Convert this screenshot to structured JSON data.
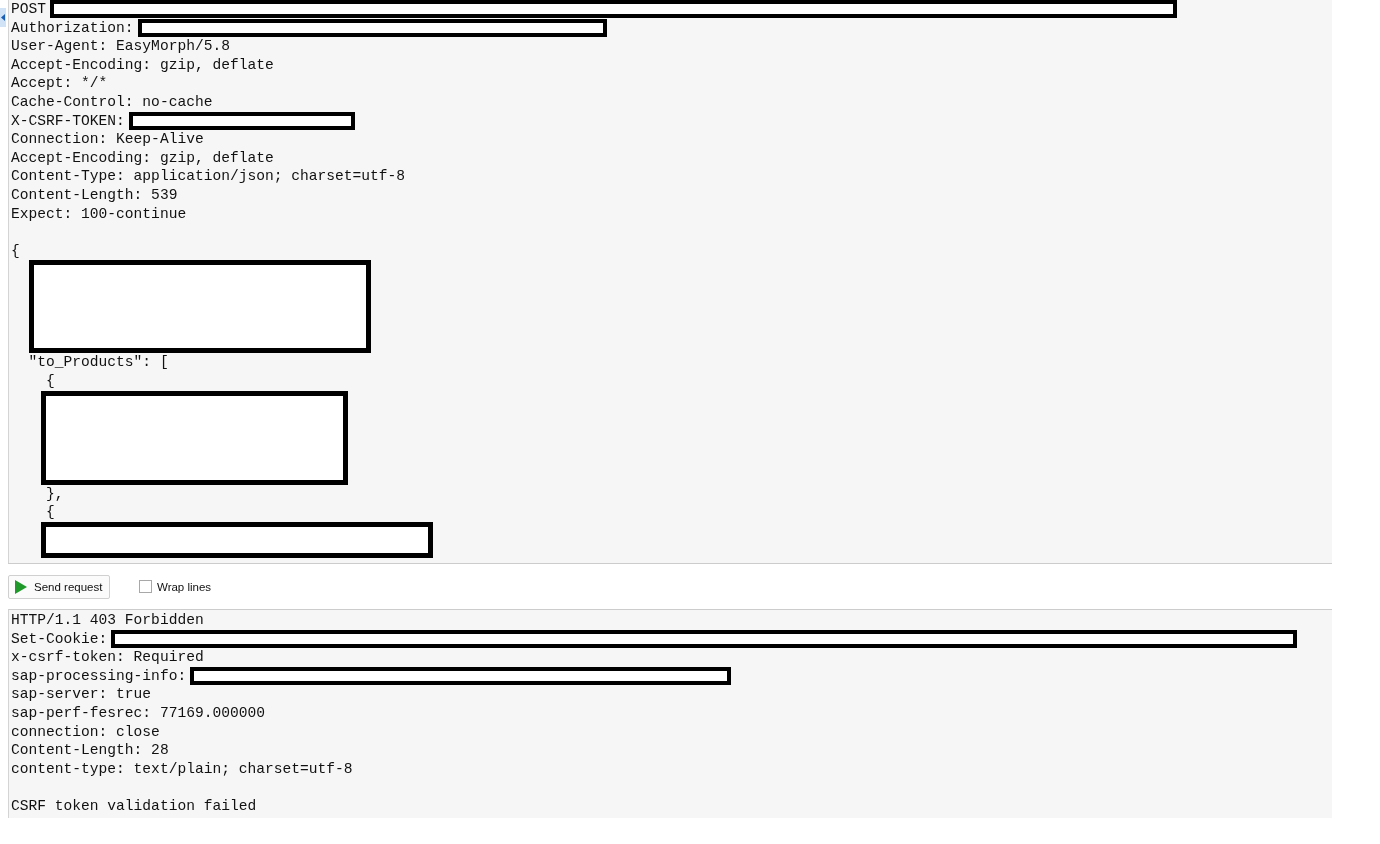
{
  "request": {
    "headers": [
      {
        "kind": "redacted",
        "text": "POST"
      },
      {
        "kind": "redacted",
        "text": "Authorization:"
      },
      {
        "kind": "plain",
        "text": "User-Agent: EasyMorph/5.8"
      },
      {
        "kind": "plain",
        "text": "Accept-Encoding: gzip, deflate"
      },
      {
        "kind": "plain",
        "text": "Accept: */*"
      },
      {
        "kind": "plain",
        "text": "Cache-Control: no-cache"
      },
      {
        "kind": "redacted",
        "text": "X-CSRF-TOKEN:"
      },
      {
        "kind": "plain",
        "text": "Connection: Keep-Alive"
      },
      {
        "kind": "plain",
        "text": "Accept-Encoding: gzip, deflate"
      },
      {
        "kind": "plain",
        "text": "Content-Type: application/json; charset=utf-8"
      },
      {
        "kind": "plain",
        "text": "Content-Length: 539"
      },
      {
        "kind": "plain",
        "text": "Expect: 100-continue"
      }
    ],
    "body": [
      {
        "kind": "text",
        "text": "{",
        "children": [
          {
            "kind": "redaction"
          },
          {
            "kind": "text",
            "text": "\"to_Products\": [",
            "children": [
              {
                "kind": "text",
                "text": "{"
              },
              {
                "kind": "redaction"
              },
              {
                "kind": "text",
                "text": "},"
              },
              {
                "kind": "text",
                "text": "{"
              },
              {
                "kind": "redaction"
              }
            ]
          }
        ]
      }
    ]
  },
  "toolbar": {
    "send_button": {
      "label": "Send request"
    },
    "wrap_lines": {
      "label": "Wrap lines",
      "checked": false
    }
  },
  "response": {
    "lines": [
      {
        "kind": "plain",
        "text": "HTTP/1.1 403 Forbidden"
      },
      {
        "kind": "redacted",
        "text": "Set-Cookie:"
      },
      {
        "kind": "plain",
        "text": "x-csrf-token: Required"
      },
      {
        "kind": "redacted",
        "text": "sap-processing-info:"
      },
      {
        "kind": "plain",
        "text": "sap-server: true"
      },
      {
        "kind": "plain",
        "text": "sap-perf-fesrec: 77169.000000"
      },
      {
        "kind": "plain",
        "text": "connection: close"
      },
      {
        "kind": "plain",
        "text": "Content-Length: 28"
      },
      {
        "kind": "plain",
        "text": "content-type: text/plain; charset=utf-8"
      },
      {
        "kind": "blank"
      },
      {
        "kind": "plain",
        "text": "CSRF token validation failed"
      }
    ]
  }
}
